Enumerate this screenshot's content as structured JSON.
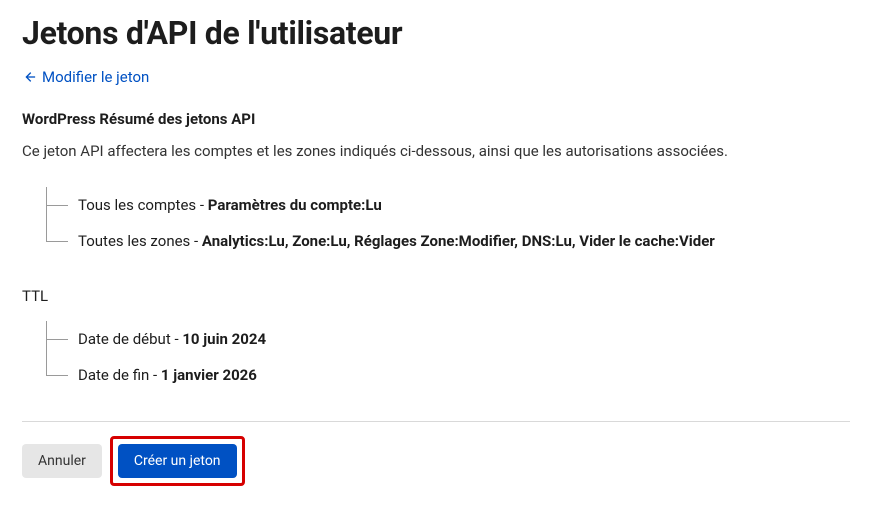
{
  "page": {
    "title": "Jetons d'API de l'utilisateur"
  },
  "back_link": {
    "label": "Modifier le jeton"
  },
  "summary": {
    "heading": "WordPress Résumé des jetons API",
    "description": "Ce jeton API affectera les comptes et les zones indiqués ci-dessous, ainsi que les autorisations associées."
  },
  "permissions": {
    "accounts": {
      "prefix": "Tous les comptes - ",
      "value": "Paramètres du compte:Lu"
    },
    "zones": {
      "prefix": "Toutes les zones - ",
      "value": "Analytics:Lu, Zone:Lu, Réglages Zone:Modifier, DNS:Lu, Vider le cache:Vider"
    }
  },
  "ttl": {
    "label": "TTL",
    "start": {
      "prefix": "Date de début - ",
      "value": "10 juin 2024"
    },
    "end": {
      "prefix": "Date de fin - ",
      "value": "1 janvier 2026"
    }
  },
  "buttons": {
    "cancel": "Annuler",
    "create": "Créer un jeton"
  }
}
